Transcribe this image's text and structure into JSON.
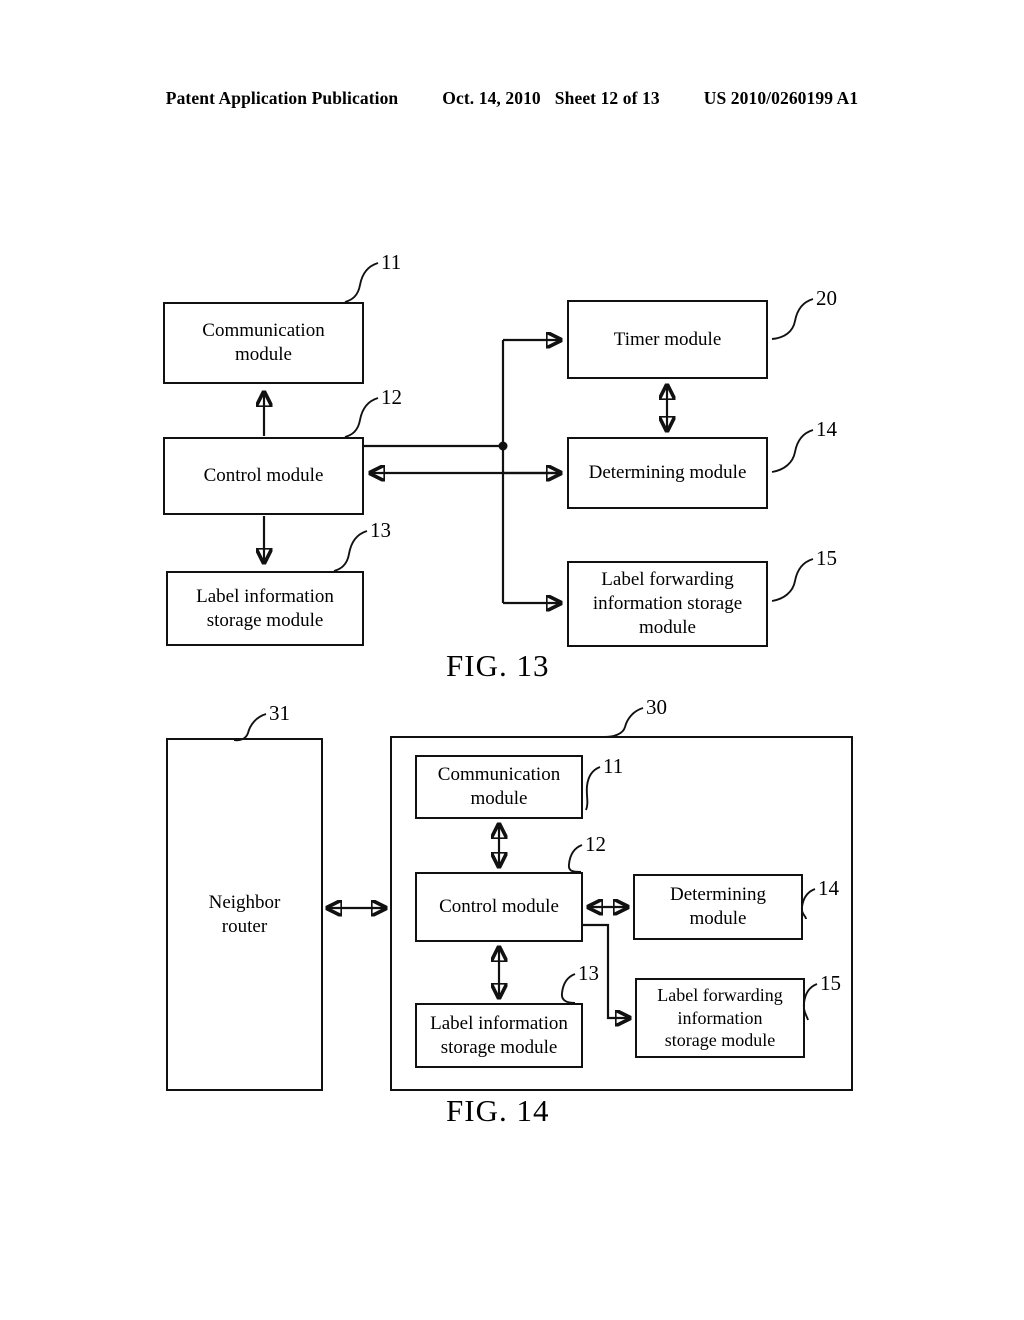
{
  "header": {
    "publication": "Patent Application Publication",
    "date": "Oct. 14, 2010",
    "sheet": "Sheet 12 of 13",
    "patent_number": "US 2010/0260199 A1"
  },
  "figures": [
    {
      "caption": "FIG. 13",
      "blocks": [
        {
          "ref": "11",
          "label": "Communication\nmodule"
        },
        {
          "ref": "12",
          "label": "Control module"
        },
        {
          "ref": "13",
          "label": "Label information\nstorage module"
        },
        {
          "ref": "20",
          "label": "Timer module"
        },
        {
          "ref": "14",
          "label": "Determining module"
        },
        {
          "ref": "15",
          "label": "Label forwarding\ninformation storage\nmodule"
        }
      ]
    },
    {
      "caption": "FIG. 14",
      "blocks": [
        {
          "ref": "31",
          "label": "Neighbor\nrouter"
        },
        {
          "ref": "30",
          "label": ""
        },
        {
          "ref": "11",
          "label": "Communication\nmodule"
        },
        {
          "ref": "12",
          "label": "Control module"
        },
        {
          "ref": "14",
          "label": "Determining\nmodule"
        },
        {
          "ref": "13",
          "label": "Label information\nstorage module"
        },
        {
          "ref": "15",
          "label": "Label forwarding\ninformation\nstorage module"
        }
      ]
    }
  ],
  "fig13": {
    "caption": "FIG. 13",
    "communication_module": {
      "label_line1": "Communication",
      "label_line2": "module",
      "ref": "11"
    },
    "control_module": {
      "label": "Control module",
      "ref": "12"
    },
    "label_info_storage_module": {
      "label_line1": "Label information",
      "label_line2": "storage module",
      "ref": "13"
    },
    "timer_module": {
      "label": "Timer module",
      "ref": "20"
    },
    "determining_module": {
      "label": "Determining module",
      "ref": "14"
    },
    "label_fwd_storage_module": {
      "label_line1": "Label forwarding",
      "label_line2": "information storage",
      "label_line3": "module",
      "ref": "15"
    }
  },
  "fig14": {
    "caption": "FIG. 14",
    "neighbor_router": {
      "label_line1": "Neighbor",
      "label_line2": "router",
      "ref": "31"
    },
    "device_container": {
      "ref": "30"
    },
    "communication_module": {
      "label_line1": "Communication",
      "label_line2": "module",
      "ref": "11"
    },
    "control_module": {
      "label": "Control module",
      "ref": "12"
    },
    "determining_module": {
      "label_line1": "Determining",
      "label_line2": "module",
      "ref": "14"
    },
    "label_info_storage_module": {
      "label_line1": "Label information",
      "label_line2": "storage module",
      "ref": "13"
    },
    "label_fwd_storage_module": {
      "label_line1": "Label forwarding",
      "label_line2": "information",
      "label_line3": "storage module",
      "ref": "15"
    }
  },
  "colors": {
    "ink": "#111111",
    "paper": "#ffffff"
  }
}
